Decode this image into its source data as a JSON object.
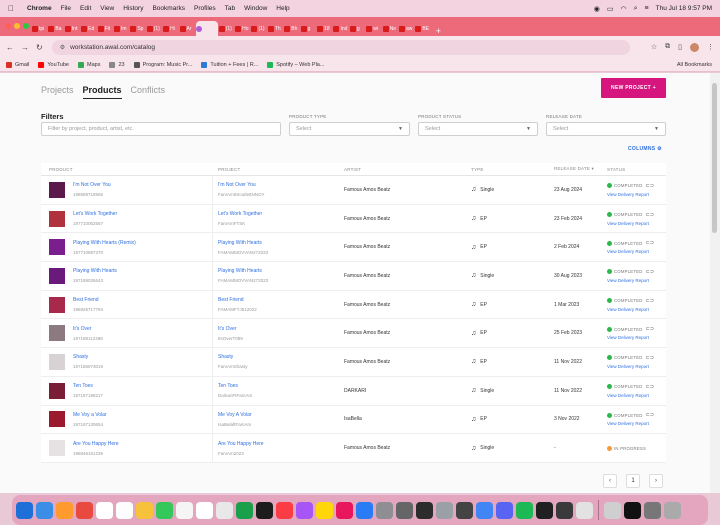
{
  "menubar": {
    "app": "Chrome",
    "items": [
      "File",
      "Edit",
      "View",
      "History",
      "Bookmarks",
      "Profiles",
      "Tab",
      "Window",
      "Help"
    ],
    "datetime": "Thu Jul 18  9:57 PM"
  },
  "tabs": [
    {
      "label": "tpi"
    },
    {
      "label": "Ba"
    },
    {
      "label": "Int"
    },
    {
      "label": "Ed"
    },
    {
      "label": "Fit"
    },
    {
      "label": "Im"
    },
    {
      "label": "Sp"
    },
    {
      "label": "(1)"
    },
    {
      "label": "Hi"
    },
    {
      "label": "Ar"
    },
    {
      "label": "",
      "active": true
    },
    {
      "label": "(1)"
    },
    {
      "label": "Ho"
    },
    {
      "label": "(1)"
    },
    {
      "label": "Th"
    },
    {
      "label": "Bh"
    },
    {
      "label": "g"
    },
    {
      "label": "18"
    },
    {
      "label": "Ind"
    },
    {
      "label": "g"
    },
    {
      "label": "wi"
    },
    {
      "label": "Ne"
    },
    {
      "label": "aw"
    },
    {
      "label": "BE"
    }
  ],
  "address": {
    "url": "workstation.awal.com/catalog"
  },
  "bookmarks": [
    {
      "label": "Gmail",
      "color": "#d93025"
    },
    {
      "label": "YouTube",
      "color": "#ff0000"
    },
    {
      "label": "Maps",
      "color": "#34a853"
    },
    {
      "label": "23",
      "color": "#888888"
    },
    {
      "label": "Program: Music Pr...",
      "color": "#555555"
    },
    {
      "label": "Tuition + Fees | R...",
      "color": "#2b7bd6"
    },
    {
      "label": "Spotify – Web Pla...",
      "color": "#1db954"
    }
  ],
  "bookmarks_all": "All Bookmarks",
  "nav": {
    "projects": "Projects",
    "products": "Products",
    "conflicts": "Conflicts"
  },
  "new_project_label": "NEW PROJECT +",
  "filters": {
    "title": "Filters",
    "search_placeholder": "Filter by project, product, artist, etc.",
    "product_type_label": "PRODUCT TYPE",
    "product_status_label": "PRODUCT STATUS",
    "release_date_label": "RELEASE DATE",
    "select_placeholder": "Select"
  },
  "columns_label": "COLUMNS",
  "table": {
    "headers": {
      "product": "PRODUCT",
      "project": "PROJECT",
      "artist": "ARTIST",
      "type": "TYPE",
      "release_date": "RELEASE DATE",
      "status": "STATUS"
    },
    "rows": [
      {
        "product": "I'm Not Over You",
        "upc": "198588718555",
        "project": "I'm Not Over You",
        "project_code": "FamAmItScarlettNNOY",
        "artist": "Famous Amos Beatz",
        "type": "Single",
        "date": "23 Aug 2024",
        "status": "COMPLETED",
        "status_color": "#2eb84b",
        "report": "View Delivery Report",
        "thumb": "#5b1a4a"
      },
      {
        "product": "Let's Work Together",
        "upc": "197710062567",
        "project": "Let's Work Together",
        "project_code": "FamAmFTSK",
        "artist": "Famous Amos Beatz",
        "type": "EP",
        "date": "23 Feb 2024",
        "status": "COMPLETED",
        "status_color": "#2eb84b",
        "report": "View Delivery Report",
        "thumb": "#b0323c"
      },
      {
        "product": "Playing With Hearts (Remix)",
        "upc": "197710887370",
        "project": "Playing With Hearts",
        "project_code": "FAMAMMOVVAN272023",
        "artist": "Famous Amos Beatz",
        "type": "EP",
        "date": "2 Feb 2024",
        "status": "COMPLETED",
        "status_color": "#2eb84b",
        "report": "View Delivery Report",
        "thumb": "#7b1f8f"
      },
      {
        "product": "Playing With Hearts",
        "upc": "197189026643",
        "project": "Playing With Hearts",
        "project_code": "FAMAMMOVVAN272023",
        "artist": "Famous Amos Beatz",
        "type": "Single",
        "date": "30 Aug 2023",
        "status": "COMPLETED",
        "status_color": "#2eb84b",
        "report": "View Delivery Report",
        "thumb": "#6a1a7a"
      },
      {
        "product": "Best Friend",
        "upc": "196925717793",
        "project": "Best Friend",
        "project_code": "FAMAMFTJ512022",
        "artist": "Famous Amos Beatz",
        "type": "EP",
        "date": "1 Mar 2023",
        "status": "COMPLETED",
        "status_color": "#2eb84b",
        "report": "View Delivery Report",
        "thumb": "#a9294d"
      },
      {
        "product": "It's Over",
        "upc": "197188112488",
        "project": "It's Over",
        "project_code": "ItsOverT089",
        "artist": "Famous Amos Beatz",
        "type": "EP",
        "date": "25 Feb 2023",
        "status": "COMPLETED",
        "status_color": "#2eb84b",
        "report": "View Delivery Report",
        "thumb": "#8c7a80"
      },
      {
        "product": "Shasty",
        "upc": "197186973019",
        "project": "Shasty",
        "project_code": "FamAmShasty",
        "artist": "Famous Amos Beatz",
        "type": "EP",
        "date": "11 Nov 2022",
        "status": "COMPLETED",
        "status_color": "#2eb84b",
        "report": "View Delivery Report",
        "thumb": "#d8d2d4"
      },
      {
        "product": "Ten Toes",
        "upc": "197187198217",
        "project": "Ten Toes",
        "project_code": "DarkariFtFamAm",
        "artist": "DARKARI",
        "type": "Single",
        "date": "11 Nov 2022",
        "status": "COMPLETED",
        "status_color": "#2eb84b",
        "report": "View Delivery Report",
        "thumb": "#7a1d36"
      },
      {
        "product": "Me Voy a Volar",
        "upc": "197187130654",
        "project": "Me Voy A Volar",
        "project_code": "IsaBelaftFamAm",
        "artist": "IsaBella",
        "type": "EP",
        "date": "3 Nov 2022",
        "status": "COMPLETED",
        "status_color": "#2eb84b",
        "report": "View Delivery Report",
        "thumb": "#9b1a2e"
      },
      {
        "product": "Are You Happy Here",
        "upc": "196946161239",
        "project": "Are You Happy Here",
        "project_code": "FamAm2023",
        "artist": "Famous Amos Beatz",
        "type": "Single",
        "date": "-",
        "status": "IN PROGRESS",
        "status_color": "#f39a3a",
        "report": "",
        "thumb": "#e6e2e4"
      }
    ]
  },
  "pagination": {
    "prev": "‹",
    "page": "1",
    "next": "›"
  },
  "dock_colors": [
    "#1f6fd9",
    "#3a8ee6",
    "#ff9a2e",
    "#e84a3f",
    "#ffffff",
    "#fdfdfd",
    "#f6c23c",
    "#34c759",
    "#f5f5f5",
    "#ffffff",
    "#e8e8e8",
    "#1aa04a",
    "#1c1c1c",
    "#fc3c44",
    "#a855f7",
    "#ffd60a",
    "#e8175d",
    "#2a7cf6",
    "#8e8e93",
    "#666666",
    "#2c2c2c",
    "#9aa0a6",
    "#444444",
    "#4285f4",
    "#5865f2",
    "#1db954",
    "#202020",
    "#3a3a3a",
    "#e2e2e2",
    "#cfcfcf",
    "#111111",
    "#777777",
    "#aaaaaa"
  ]
}
